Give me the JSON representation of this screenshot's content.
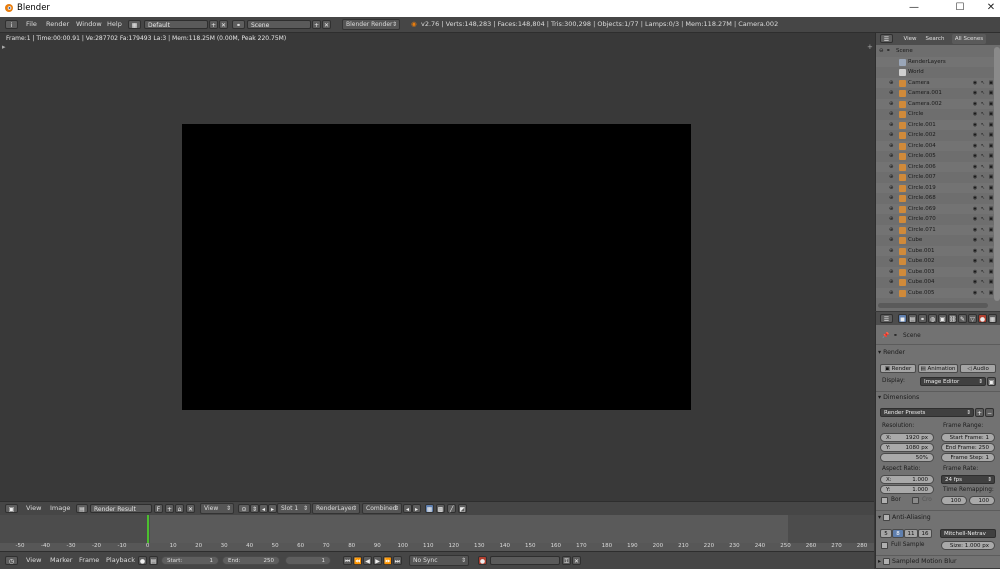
{
  "window": {
    "title": "Blender",
    "minimize": "—",
    "maximize": "☐",
    "close": "✕"
  },
  "info_header": {
    "menus": [
      "File",
      "Render",
      "Window",
      "Help"
    ],
    "layout": "Default",
    "scene": "Scene",
    "engine": "Blender Render",
    "stats": "v2.76 | Verts:148,283 | Faces:148,804 | Tris:300,298 | Objects:1/77 | Lamps:0/3 | Mem:118.27M | Camera.002"
  },
  "viewer": {
    "frame_stats": "Frame:1 | Time:00:00.91 | Ve:287702 Fa:179493 La:3 | Mem:118.25M (0.00M, Peak 220.75M)"
  },
  "image_header": {
    "menus": [
      "View",
      "Image"
    ],
    "image_name": "Render Result",
    "fake_user": "F",
    "view": "View",
    "slot": "Slot 1",
    "render_layer": "RenderLayer",
    "pass": "Combined"
  },
  "timeline": {
    "ticks": [
      "-50",
      "-40",
      "-30",
      "-20",
      "-10",
      "0",
      "10",
      "20",
      "30",
      "40",
      "50",
      "60",
      "70",
      "80",
      "90",
      "100",
      "110",
      "120",
      "130",
      "140",
      "150",
      "160",
      "170",
      "180",
      "190",
      "200",
      "210",
      "220",
      "230",
      "240",
      "250",
      "260",
      "270",
      "280"
    ],
    "menus": [
      "View",
      "Marker",
      "Frame",
      "Playback"
    ],
    "start_label": "Start:",
    "start_value": "1",
    "end_label": "End:",
    "end_value": "250",
    "current_frame": "1",
    "sync": "No Sync",
    "current_frame_position": 0
  },
  "outliner": {
    "tabs": [
      "View",
      "Search",
      "All Scenes"
    ],
    "scene": "Scene",
    "items": [
      "RenderLayers",
      "World",
      "Camera",
      "Camera.001",
      "Camera.002",
      "Circle",
      "Circle.001",
      "Circle.002",
      "Circle.004",
      "Circle.005",
      "Circle.006",
      "Circle.007",
      "Circle.019",
      "Circle.068",
      "Circle.069",
      "Circle.070",
      "Circle.071",
      "Cube",
      "Cube.001",
      "Cube.002",
      "Cube.003",
      "Cube.004",
      "Cube.005"
    ]
  },
  "properties": {
    "context": "Scene",
    "render_panel": "Render",
    "render_button": "Render",
    "animation_button": "Animation",
    "audio_button": "Audio",
    "display_label": "Display:",
    "display_value": "Image Editor",
    "dimensions_panel": "Dimensions",
    "render_presets": "Render Presets",
    "resolution_label": "Resolution:",
    "res_x_label": "X:",
    "res_x": "1920 px",
    "res_y_label": "Y:",
    "res_y": "1080 px",
    "res_pct": "50%",
    "frame_range_label": "Frame Range:",
    "start_frame": "Start Frame: 1",
    "end_frame": "End Frame: 250",
    "frame_step": "Frame Step: 1",
    "aspect_label": "Aspect Ratio:",
    "aspect_x_label": "X:",
    "aspect_x": "1.000",
    "aspect_y_label": "Y:",
    "aspect_y": "1.000",
    "frame_rate_label": "Frame Rate:",
    "frame_rate": "24 fps",
    "time_remap_label": "Time Remapping:",
    "remap_old": "100",
    "remap_new": "100",
    "border_label": "Bor",
    "crop_label": "Cro",
    "aa_panel": "Anti-Aliasing",
    "aa_samples": [
      "5",
      "8",
      "11",
      "16"
    ],
    "aa_filter": "Mitchell-Netrav",
    "full_sample": "Full Sample",
    "aa_size": "Size: 1.000 px",
    "motion_blur_panel": "Sampled Motion Blur"
  }
}
